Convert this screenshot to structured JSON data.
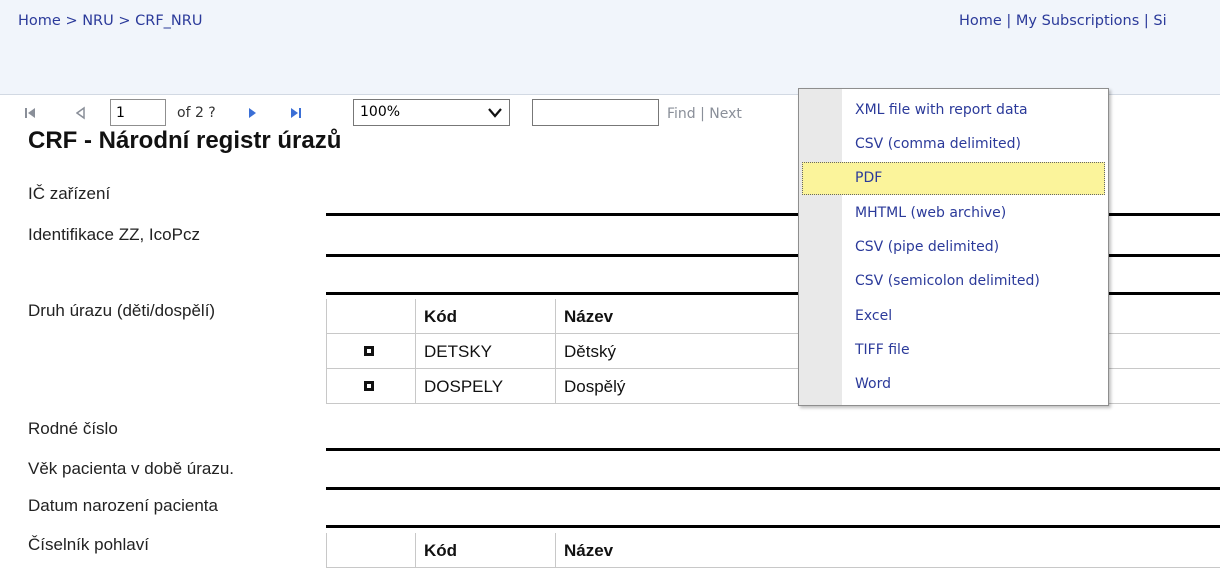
{
  "breadcrumb": {
    "home": "Home",
    "sep1": ">",
    "nru": "NRU",
    "sep2": ">",
    "crf": "CRF_NRU"
  },
  "top_links": {
    "text": "Home | My Subscriptions | Si"
  },
  "toolbar": {
    "page_value": "1",
    "page_of": "of 2 ?",
    "zoom_value": "100%",
    "find_value": "",
    "find_next": "Find | Next"
  },
  "report": {
    "title": "CRF - Národní registr úrazů",
    "labels": {
      "ic": "IČ zařízení",
      "identifikace": "Identifikace ZZ, IcoPcz",
      "druh": "Druh úrazu (děti/dospělí)",
      "rodne": "Rodné číslo",
      "vek": "Věk pacienta v době úrazu.",
      "datum": "Datum narození pacienta",
      "pohlavi": "Číselník pohlaví"
    },
    "table1": {
      "header": {
        "kod": "Kód",
        "nazev": "Název"
      },
      "rows": [
        {
          "kod": "DETSKY",
          "nazev": "Dětský"
        },
        {
          "kod": "DOSPELY",
          "nazev": "Dospělý"
        }
      ]
    },
    "table2": {
      "header": {
        "kod": "Kód",
        "nazev": "Název"
      }
    }
  },
  "export_menu": {
    "items": [
      "XML file with report data",
      "CSV (comma delimited)",
      "PDF",
      "MHTML (web archive)",
      "CSV (pipe delimited)",
      "CSV (semicolon delimited)",
      "Excel",
      "TIFF file",
      "Word"
    ],
    "highlighted": "PDF"
  },
  "icons": {
    "first_page": "first-page-icon",
    "prev_page": "prev-page-icon",
    "next_page": "next-page-icon",
    "last_page": "last-page-icon",
    "export": "save-export-icon",
    "refresh": "refresh-icon",
    "print": "print-icon",
    "data_feed": "data-feed-icon"
  },
  "colors": {
    "link": "#2b3a9a",
    "toolbar_bg": "#f1f5fb",
    "menu_highlight": "#fbf49b",
    "nav_active": "#3b6fd6"
  }
}
